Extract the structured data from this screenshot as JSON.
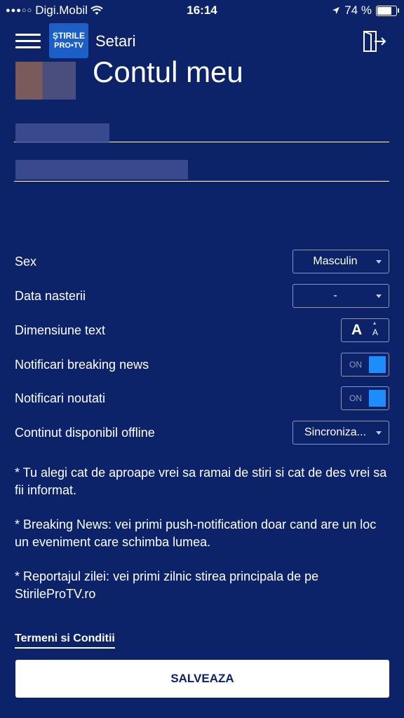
{
  "status_bar": {
    "carrier": "Digi.Mobil",
    "time": "16:14",
    "battery": "74 %"
  },
  "nav": {
    "logo_line1": "ȘTIRILE",
    "logo_line2": "PRO•TV",
    "title": "Setari"
  },
  "account": {
    "title": "Contul meu"
  },
  "settings": {
    "sex_label": "Sex",
    "sex_value": "Masculin",
    "birthdate_label": "Data nasterii",
    "birthdate_value": "-",
    "textsize_label": "Dimensiune text",
    "textsize_big": "A",
    "textsize_small": "A",
    "breaking_label": "Notificari breaking news",
    "breaking_state": "ON",
    "news_label": "Notificari noutati",
    "news_state": "ON",
    "offline_label": "Continut disponibil offline",
    "offline_value": "Sincroniza..."
  },
  "notes": {
    "note1": "* Tu alegi cat de aproape vrei sa ramai de stiri si cat de des vrei sa fii informat.",
    "note2": "* Breaking News: vei primi push-notification doar cand are un loc un eveniment care schimba lumea.",
    "note3": "* Reportajul zilei: vei primi zilnic stirea principala de pe StirileProTV.ro"
  },
  "footer": {
    "terms": "Termeni si Conditii",
    "save": "SALVEAZA"
  },
  "colors": {
    "background": "#0c2369",
    "toggle_on": "#1e8cfa",
    "logo_blue": "#1b5fc7"
  }
}
